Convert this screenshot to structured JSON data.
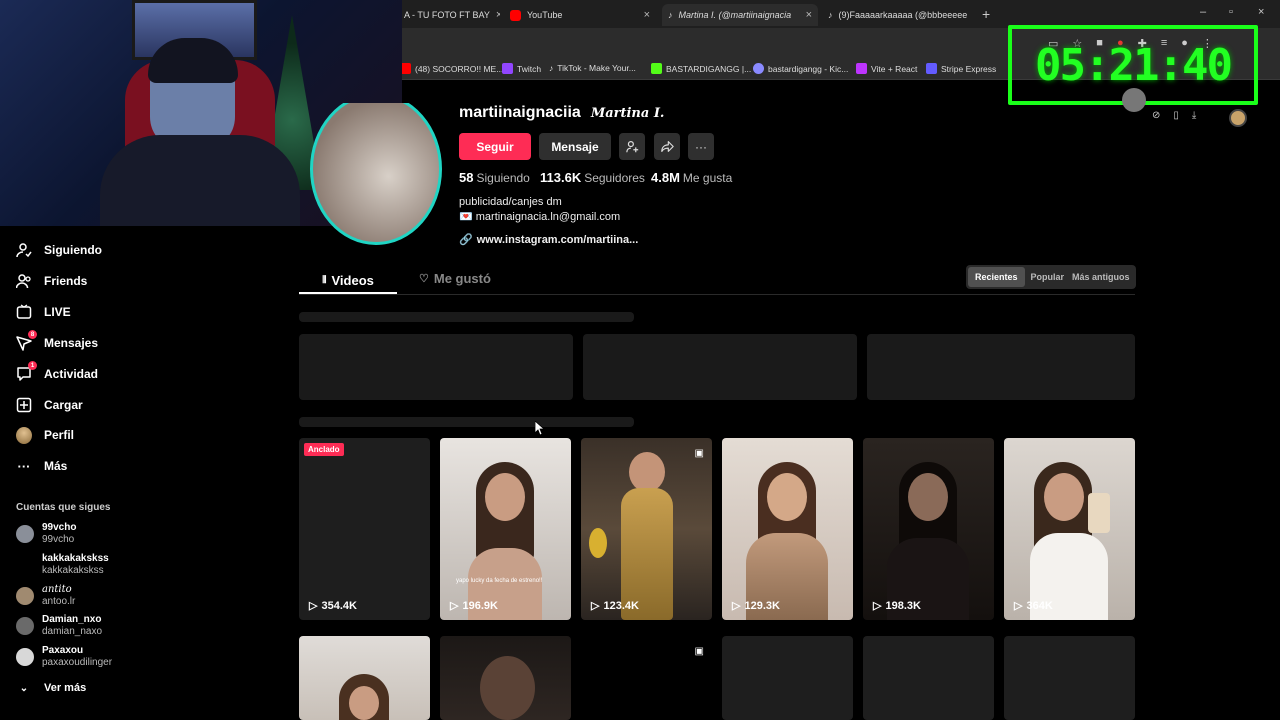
{
  "tabs": [
    {
      "label": "A - TU FOTO FT BAY",
      "icon": "tiktok-icon"
    },
    {
      "label": "YouTube",
      "icon": "youtube-icon"
    },
    {
      "label": "Martina I. (@martiinaignacia",
      "icon": "tiktok-icon"
    },
    {
      "label": "(9)Faaaaarkaaaaa (@bbbeeeee",
      "icon": "tiktok-icon"
    }
  ],
  "bookmarks": [
    {
      "label": "(48) SOCORRO!! ME...",
      "color": "#ff0000"
    },
    {
      "label": "Twitch",
      "color": "#9146ff"
    },
    {
      "label": "TikTok - Make Your...",
      "color": "#ffffff"
    },
    {
      "label": "BASTARDIGANGG |...",
      "color": "#53fc18"
    },
    {
      "label": "bastardigangg - Kic...",
      "color": "#8a8aff"
    },
    {
      "label": "Vite + React",
      "color": "#bd34fe"
    },
    {
      "label": "Stripe Express",
      "color": "#635bff"
    }
  ],
  "timer": "05:21:40",
  "sidebar": {
    "items": [
      {
        "label": "Siguiendo",
        "icon": "user-follow-icon"
      },
      {
        "label": "Friends",
        "icon": "friends-icon"
      },
      {
        "label": "LIVE",
        "icon": "live-icon"
      },
      {
        "label": "Mensajes",
        "icon": "messages-icon",
        "badge": "8"
      },
      {
        "label": "Actividad",
        "icon": "activity-icon",
        "badge": "1"
      },
      {
        "label": "Cargar",
        "icon": "upload-icon"
      },
      {
        "label": "Perfil",
        "icon": "avatar-icon"
      },
      {
        "label": "Más",
        "icon": "more-icon"
      }
    ],
    "following_heading": "Cuentas que sigues",
    "following": [
      {
        "name": "99vcho",
        "handle": "99vcho"
      },
      {
        "name": "kakkakakskss",
        "handle": "kakkakakskss"
      },
      {
        "name": "antito",
        "handle": "antoo.lr"
      },
      {
        "name": "Damian_nxo",
        "handle": "damian_naxo"
      },
      {
        "name": "Paxaxou",
        "handle": "paxaxoudilinger"
      }
    ],
    "see_more": "Ver más"
  },
  "profile": {
    "username": "martiinaignaciia",
    "display_name": "Martina I.",
    "follow_label": "Seguir",
    "message_label": "Mensaje",
    "stats": [
      {
        "value": "58",
        "label": "Siguiendo"
      },
      {
        "value": "113.6K",
        "label": "Seguidores"
      },
      {
        "value": "4.8M",
        "label": "Me gusta"
      }
    ],
    "bio_line1": "publicidad/canjes dm",
    "bio_line2": "💌 martinaignacia.ln@gmail.com",
    "link": "www.instagram.com/martiina..."
  },
  "content_tabs": {
    "videos": "Videos",
    "liked": "Me gustó"
  },
  "sort": {
    "recent": "Recientes",
    "popular": "Popular",
    "oldest": "Más antiguos"
  },
  "videos": [
    {
      "views": "354.4K",
      "pinned_label": "Anclado",
      "caption": ""
    },
    {
      "views": "196.9K",
      "caption": "yapo lucky da fecha de estreno!!"
    },
    {
      "views": "123.4K",
      "caption": ""
    },
    {
      "views": "129.3K",
      "caption": ""
    },
    {
      "views": "198.3K",
      "caption": ""
    },
    {
      "views": "364K",
      "caption": ""
    }
  ]
}
